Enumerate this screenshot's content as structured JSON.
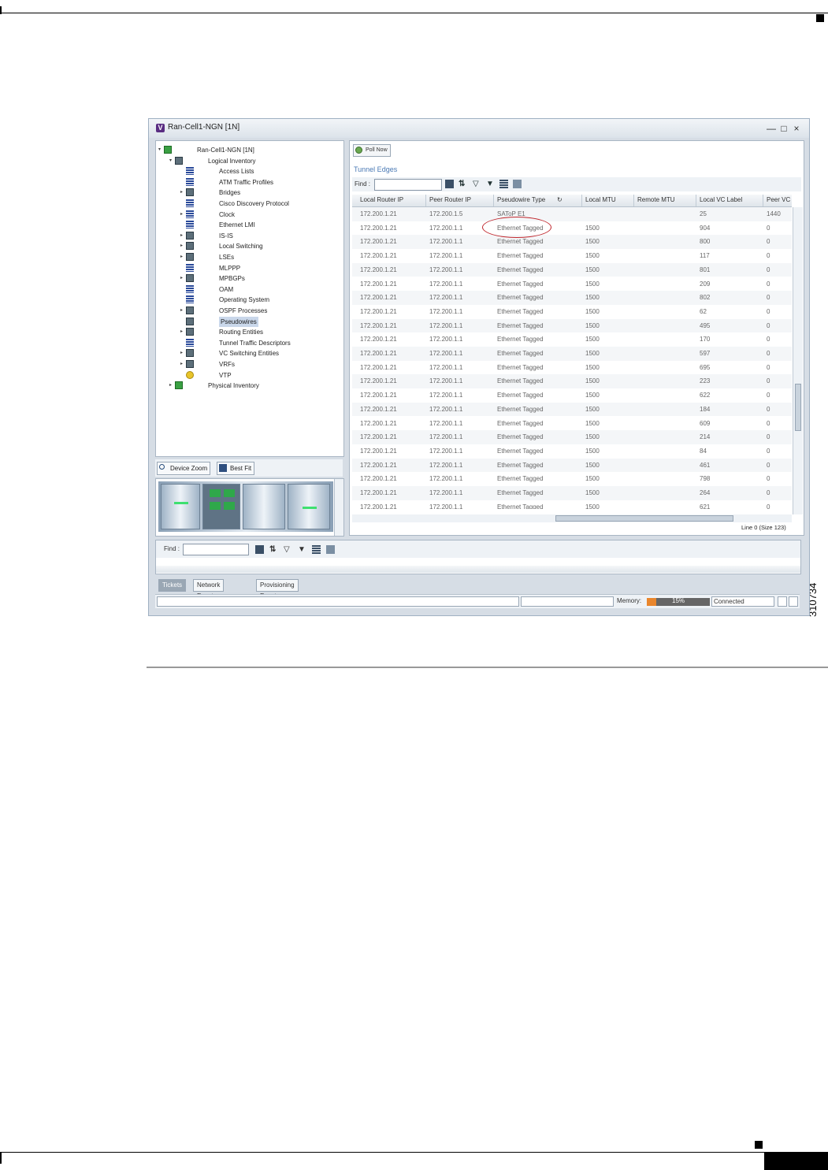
{
  "figure_id": "310734",
  "window": {
    "title": "Ran-Cell1-NGN [1N]",
    "logo": "V"
  },
  "tree": {
    "items": [
      {
        "label": "Ran-Cell1-NGN [1N]",
        "icon": "network-element-icon"
      },
      {
        "label": "Logical Inventory",
        "icon": "logical-inventory-icon"
      },
      {
        "label": "Access Lists",
        "icon": "list-icon"
      },
      {
        "label": "ATM Traffic Profiles",
        "icon": "list-icon"
      },
      {
        "label": "Bridges",
        "icon": "folder-icon"
      },
      {
        "label": "Cisco Discovery Protocol",
        "icon": "list-icon"
      },
      {
        "label": "Clock",
        "icon": "list-icon"
      },
      {
        "label": "Ethernet LMI",
        "icon": "list-icon"
      },
      {
        "label": "IS-IS",
        "icon": "folder-icon"
      },
      {
        "label": "Local Switching",
        "icon": "folder-icon"
      },
      {
        "label": "LSEs",
        "icon": "folder-icon"
      },
      {
        "label": "MLPPP",
        "icon": "list-icon"
      },
      {
        "label": "MPBGPs",
        "icon": "folder-icon"
      },
      {
        "label": "OAM",
        "icon": "list-icon"
      },
      {
        "label": "Operating System",
        "icon": "list-icon"
      },
      {
        "label": "OSPF Processes",
        "icon": "folder-icon"
      },
      {
        "label": "Pseudowires",
        "icon": "folder-icon"
      },
      {
        "label": "Routing Entities",
        "icon": "folder-icon"
      },
      {
        "label": "Tunnel Traffic Descriptors",
        "icon": "list-icon"
      },
      {
        "label": "VC Switching Entities",
        "icon": "folder-icon"
      },
      {
        "label": "VRFs",
        "icon": "folder-icon"
      },
      {
        "label": "VTP",
        "icon": "vtp-icon"
      },
      {
        "label": "Physical Inventory",
        "icon": "physical-inventory-icon"
      }
    ]
  },
  "device_toolbar": {
    "zoom_label": "Device Zoom",
    "bestfit_label": "Best Fit"
  },
  "poll_now": "Poll Now",
  "section_title": "Tunnel Edges",
  "find_label": "Find :",
  "lower_find_label": "Find :",
  "table": {
    "columns": [
      "Local Router IP",
      "Peer Router IP",
      "Pseudowire Type",
      "Local MTU",
      "Remote MTU",
      "Local VC Label",
      "Peer VC"
    ],
    "rows": [
      [
        "172.200.1.21",
        "172.200.1.5",
        "SAToP E1",
        "",
        "",
        "25",
        "1440"
      ],
      [
        "172.200.1.21",
        "172.200.1.1",
        "Ethernet Tagged",
        "1500",
        "",
        "904",
        "0"
      ],
      [
        "172.200.1.21",
        "172.200.1.1",
        "Ethernet Tagged",
        "1500",
        "",
        "800",
        "0"
      ],
      [
        "172.200.1.21",
        "172.200.1.1",
        "Ethernet Tagged",
        "1500",
        "",
        "117",
        "0"
      ],
      [
        "172.200.1.21",
        "172.200.1.1",
        "Ethernet Tagged",
        "1500",
        "",
        "801",
        "0"
      ],
      [
        "172.200.1.21",
        "172.200.1.1",
        "Ethernet Tagged",
        "1500",
        "",
        "209",
        "0"
      ],
      [
        "172.200.1.21",
        "172.200.1.1",
        "Ethernet Tagged",
        "1500",
        "",
        "802",
        "0"
      ],
      [
        "172.200.1.21",
        "172.200.1.1",
        "Ethernet Tagged",
        "1500",
        "",
        "62",
        "0"
      ],
      [
        "172.200.1.21",
        "172.200.1.1",
        "Ethernet Tagged",
        "1500",
        "",
        "495",
        "0"
      ],
      [
        "172.200.1.21",
        "172.200.1.1",
        "Ethernet Tagged",
        "1500",
        "",
        "170",
        "0"
      ],
      [
        "172.200.1.21",
        "172.200.1.1",
        "Ethernet Tagged",
        "1500",
        "",
        "597",
        "0"
      ],
      [
        "172.200.1.21",
        "172.200.1.1",
        "Ethernet Tagged",
        "1500",
        "",
        "695",
        "0"
      ],
      [
        "172.200.1.21",
        "172.200.1.1",
        "Ethernet Tagged",
        "1500",
        "",
        "223",
        "0"
      ],
      [
        "172.200.1.21",
        "172.200.1.1",
        "Ethernet Tagged",
        "1500",
        "",
        "622",
        "0"
      ],
      [
        "172.200.1.21",
        "172.200.1.1",
        "Ethernet Tagged",
        "1500",
        "",
        "184",
        "0"
      ],
      [
        "172.200.1.21",
        "172.200.1.1",
        "Ethernet Tagged",
        "1500",
        "",
        "609",
        "0"
      ],
      [
        "172.200.1.21",
        "172.200.1.1",
        "Ethernet Tagged",
        "1500",
        "",
        "214",
        "0"
      ],
      [
        "172.200.1.21",
        "172.200.1.1",
        "Ethernet Tagged",
        "1500",
        "",
        "84",
        "0"
      ],
      [
        "172.200.1.21",
        "172.200.1.1",
        "Ethernet Tagged",
        "1500",
        "",
        "461",
        "0"
      ],
      [
        "172.200.1.21",
        "172.200.1.1",
        "Ethernet Tagged",
        "1500",
        "",
        "798",
        "0"
      ],
      [
        "172.200.1.21",
        "172.200.1.1",
        "Ethernet Tagged",
        "1500",
        "",
        "264",
        "0"
      ],
      [
        "172.200.1.21",
        "172.200.1.1",
        "Ethernet Tagged",
        "1500",
        "",
        "621",
        "0"
      ]
    ]
  },
  "table_status": "Line 0 (Size 123)",
  "lower_tabs": [
    "Tickets",
    "Network Events",
    "Provisioning Events"
  ],
  "statusbar": {
    "memory_label": "Memory:",
    "memory_percent": "15%",
    "memory_fraction": 0.15,
    "connection": "Connected"
  },
  "colors": {
    "highlight_circle": "#c0272d",
    "memory_fill": "#e9862c"
  }
}
